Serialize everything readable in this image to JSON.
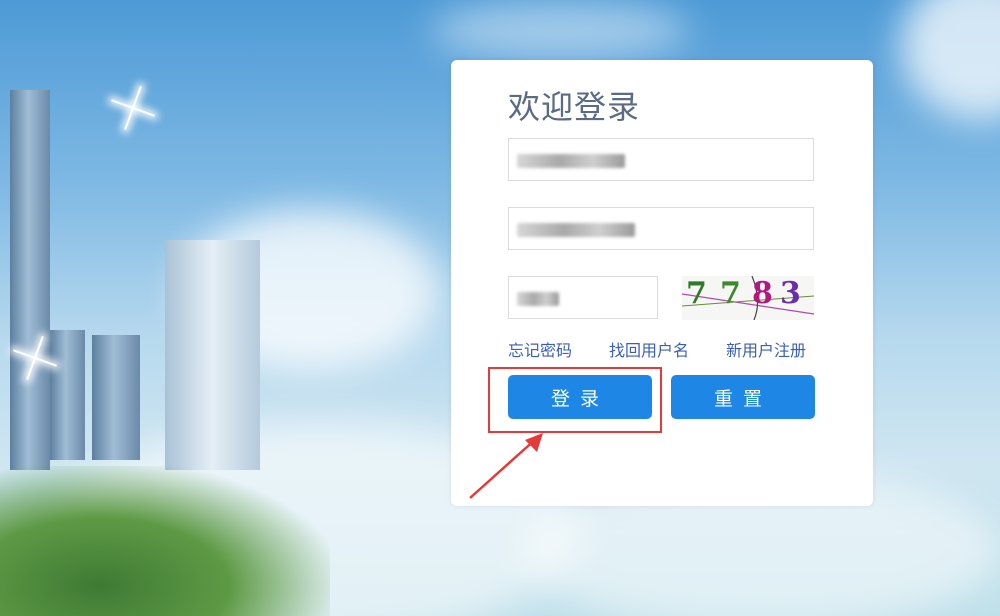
{
  "login": {
    "title": "欢迎登录",
    "username_value": "",
    "password_value": "",
    "captcha_input_value": "",
    "captcha_text": "7783",
    "links": {
      "forgot_password": "忘记密码",
      "recover_username": "找回用户名",
      "register": "新用户注册"
    },
    "buttons": {
      "login": "登录",
      "reset": "重置"
    }
  },
  "colors": {
    "button": "#1e86e5",
    "link": "#3b5fb8",
    "title": "#5b6b85",
    "annotation": "#e53a3a"
  },
  "annotation": {
    "highlight_target": "login-button",
    "arrow_icon": "arrow-icon"
  }
}
